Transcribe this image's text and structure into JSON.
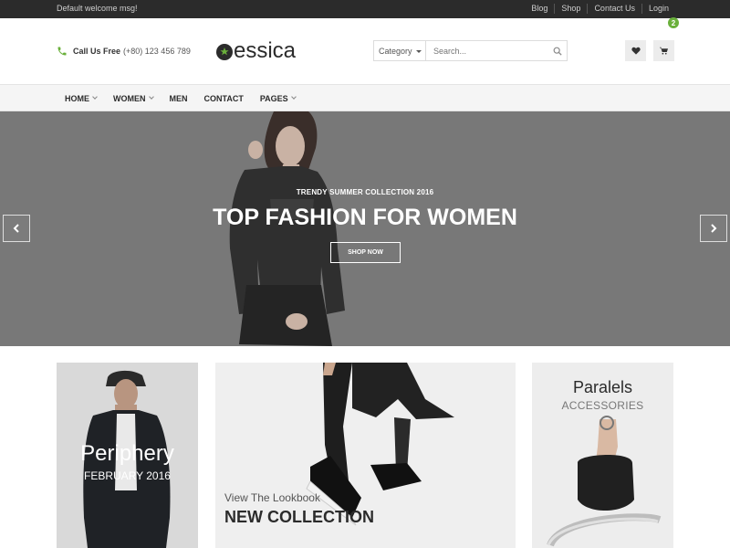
{
  "topbar": {
    "welcome": "Default welcome msg!",
    "links": [
      "Blog",
      "Shop",
      "Contact Us",
      "Login"
    ]
  },
  "header": {
    "phone_label": "Call Us Free",
    "phone_number": "(+80) 123 456 789",
    "logo_text": "essica",
    "search": {
      "category": "Category",
      "placeholder": "Search..."
    },
    "cart_count": "2",
    "icons": {
      "phone": "phone-icon",
      "wishlist": "heart-icon",
      "cart": "cart-icon",
      "search": "search-icon"
    },
    "accent_color": "#6ab03b"
  },
  "nav": {
    "items": [
      {
        "label": "HOME"
      },
      {
        "label": "WOMEN"
      },
      {
        "label": "MEN"
      },
      {
        "label": "CONTACT"
      },
      {
        "label": "PAGES"
      }
    ]
  },
  "hero": {
    "subtitle": "TRENDY SUMMER COLLECTION 2016",
    "title": "TOP FASHION FOR WOMEN",
    "button": "SHOP NOW"
  },
  "promos": {
    "left": {
      "title": "Periphery",
      "subtitle": "FEBRUARY 2016"
    },
    "center": {
      "subtitle": "View The Lookbook",
      "title": "NEW COLLECTION"
    },
    "right": {
      "title": "Paralels",
      "subtitle": "ACCESSORIES"
    }
  }
}
